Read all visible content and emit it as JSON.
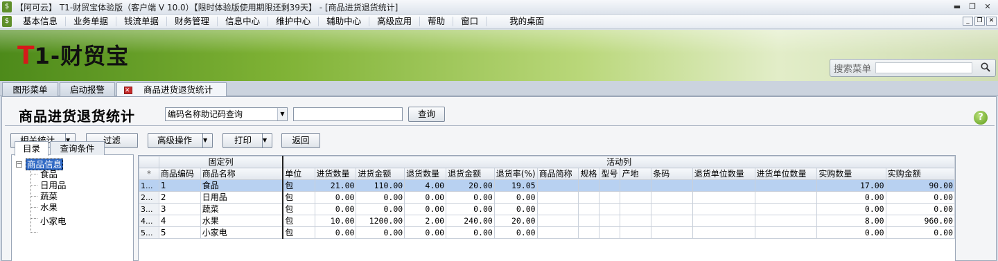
{
  "window": {
    "title": "【阿可云】 T1-财贸宝体验版（客户端 V 10.0）【限时体验版使用期限还剩39天】 - [商品进货退货统计]"
  },
  "menubar": {
    "items": [
      "基本信息",
      "业务单据",
      "钱流单据",
      "财务管理",
      "信息中心",
      "维护中心",
      "辅助中心",
      "高级应用",
      "帮助",
      "窗口",
      "我的桌面"
    ]
  },
  "banner": {
    "logo_t": "T",
    "logo_rest": "1-财贸宝",
    "search_label": "搜索菜单",
    "search_value": ""
  },
  "tabs": [
    "图形菜单",
    "启动报警",
    "商品进货退货统计"
  ],
  "page": {
    "title": "商品进货退货统计",
    "query_type": "编码名称助记码查询",
    "query_value": "",
    "query_button": "查询",
    "help": "?"
  },
  "toolbar": {
    "stats": "相关统计",
    "filter": "过滤",
    "advanced": "高级操作",
    "print": "打印",
    "back": "返回"
  },
  "sidebar": {
    "tabs": [
      "目录",
      "查询条件"
    ],
    "root": "商品信息",
    "children": [
      "食品",
      "日用品",
      "蔬菜",
      "水果",
      "小家电"
    ]
  },
  "grid": {
    "group_fixed": "固定列",
    "group_active": "活动列",
    "corner": "*",
    "fixed_columns": [
      "商品编码",
      "商品名称"
    ],
    "active_columns": [
      "单位",
      "进货数量",
      "进货金额",
      "退货数量",
      "退货金额",
      "退货率(%)",
      "商品简称",
      "规格",
      "型号",
      "产地",
      "条码",
      "退货单位数量",
      "进货单位数量",
      "实购数量",
      "实购金额"
    ],
    "rows": [
      {
        "rn": "1...",
        "code": "1",
        "name": "食品",
        "unit": "包",
        "in_qty": "21.00",
        "in_amt": "110.00",
        "ret_qty": "4.00",
        "ret_amt": "20.00",
        "ret_rate": "19.05",
        "abbr": "",
        "spec": "",
        "model": "",
        "origin": "",
        "barcode": "",
        "ret_unit_qty": "",
        "in_unit_qty": "",
        "real_qty": "17.00",
        "real_amt": "90.00"
      },
      {
        "rn": "2...",
        "code": "2",
        "name": "日用品",
        "unit": "包",
        "in_qty": "0.00",
        "in_amt": "0.00",
        "ret_qty": "0.00",
        "ret_amt": "0.00",
        "ret_rate": "0.00",
        "abbr": "",
        "spec": "",
        "model": "",
        "origin": "",
        "barcode": "",
        "ret_unit_qty": "",
        "in_unit_qty": "",
        "real_qty": "0.00",
        "real_amt": "0.00"
      },
      {
        "rn": "3...",
        "code": "3",
        "name": "蔬菜",
        "unit": "包",
        "in_qty": "0.00",
        "in_amt": "0.00",
        "ret_qty": "0.00",
        "ret_amt": "0.00",
        "ret_rate": "0.00",
        "abbr": "",
        "spec": "",
        "model": "",
        "origin": "",
        "barcode": "",
        "ret_unit_qty": "",
        "in_unit_qty": "",
        "real_qty": "0.00",
        "real_amt": "0.00"
      },
      {
        "rn": "4...",
        "code": "4",
        "name": "水果",
        "unit": "包",
        "in_qty": "10.00",
        "in_amt": "1200.00",
        "ret_qty": "2.00",
        "ret_amt": "240.00",
        "ret_rate": "20.00",
        "abbr": "",
        "spec": "",
        "model": "",
        "origin": "",
        "barcode": "",
        "ret_unit_qty": "",
        "in_unit_qty": "",
        "real_qty": "8.00",
        "real_amt": "960.00"
      },
      {
        "rn": "5...",
        "code": "5",
        "name": "小家电",
        "unit": "包",
        "in_qty": "0.00",
        "in_amt": "0.00",
        "ret_qty": "0.00",
        "ret_amt": "0.00",
        "ret_rate": "0.00",
        "abbr": "",
        "spec": "",
        "model": "",
        "origin": "",
        "barcode": "",
        "ret_unit_qty": "",
        "in_unit_qty": "",
        "real_qty": "0.00",
        "real_amt": "0.00"
      }
    ]
  },
  "colors": {
    "accent_green": "#7fb235",
    "selection": "#b8d1f1",
    "logo_red": "#d51a1a"
  }
}
